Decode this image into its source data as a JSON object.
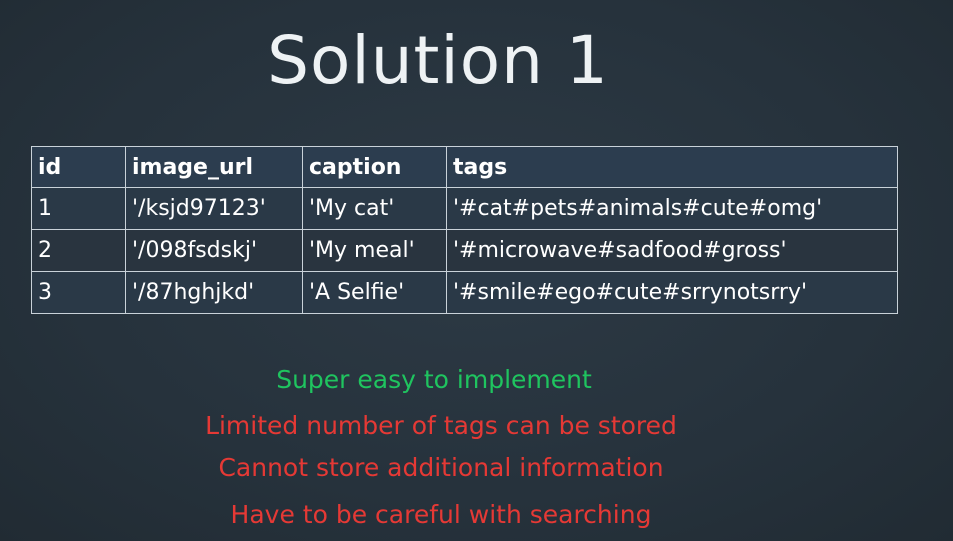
{
  "slide": {
    "title": "Solution 1"
  },
  "table": {
    "headers": [
      "id",
      "image_url",
      "caption",
      "tags"
    ],
    "rows": [
      [
        "1",
        "'/ksjd97123'",
        "'My cat'",
        "'#cat#pets#animals#cute#omg'"
      ],
      [
        "2",
        "'/098fsdskj'",
        "'My meal'",
        "'#microwave#sadfood#gross'"
      ],
      [
        "3",
        "'/87hghjkd'",
        "'A Selfie'",
        "'#smile#ego#cute#srrynotsrry'"
      ]
    ]
  },
  "notes": {
    "pros": [
      "Super easy to implement"
    ],
    "cons": [
      "Limited number of tags can be stored",
      "Cannot store additional information",
      "Have to be careful with searching"
    ]
  },
  "colors": {
    "background": "#26323c",
    "title": "#eef2f4",
    "pro": "#1fc45f",
    "con": "#e53935",
    "table_border": "#c9d2d9"
  }
}
